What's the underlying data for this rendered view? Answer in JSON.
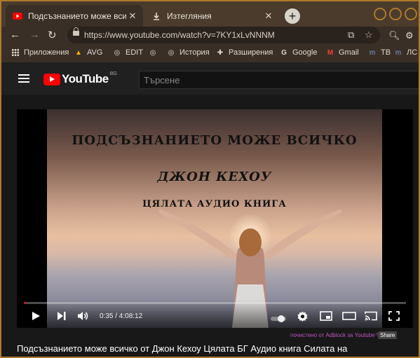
{
  "browser": {
    "tabs": [
      {
        "title": "Подсъзнанието може всичко о",
        "active": true
      },
      {
        "title": "Изтегляния",
        "active": false
      }
    ],
    "new_tab": "+",
    "url": "https://www.youtube.com/watch?v=7KY1xLvNNNM",
    "bookmarks": [
      {
        "label": "Приложения",
        "icon": "apps-grid-icon"
      },
      {
        "label": "AVG",
        "icon": "avg-icon"
      },
      {
        "label": "EDIT",
        "icon": "globe-icon"
      },
      {
        "label": "",
        "icon": "globe-icon"
      },
      {
        "label": "История",
        "icon": "globe-icon"
      },
      {
        "label": "Разширения",
        "icon": "puzzle-icon"
      },
      {
        "label": "Google",
        "icon": "google-icon"
      },
      {
        "label": "Gmail",
        "icon": "gmail-icon"
      },
      {
        "label": "TB",
        "icon": "m-icon"
      },
      {
        "label": "ЛС",
        "icon": "m-icon"
      }
    ]
  },
  "youtube": {
    "logo_text": "YouTube",
    "region": "BG",
    "search_placeholder": "Търсене"
  },
  "video": {
    "overlay_line1": "ПОДСЪЗНАНИЕТО МОЖЕ ВСИЧКО",
    "overlay_line2": "ДЖОН КЕХОУ",
    "overlay_line3": "ЦЯЛАТА АУДИО КНИГА",
    "time": "0:35 / 4:08:12",
    "progress_fraction": 0.0023,
    "adblock_note": "почистено от Adblock за Youtube™",
    "share_label": "Share",
    "title": "Подсъзнанието може всичко от Джон Кехоу Цялата БГ Аудио книга Силата на"
  },
  "colors": {
    "youtube_red": "#ff0000",
    "frame_border": "#b07a2a",
    "browser_chrome": "#3a2f26"
  }
}
